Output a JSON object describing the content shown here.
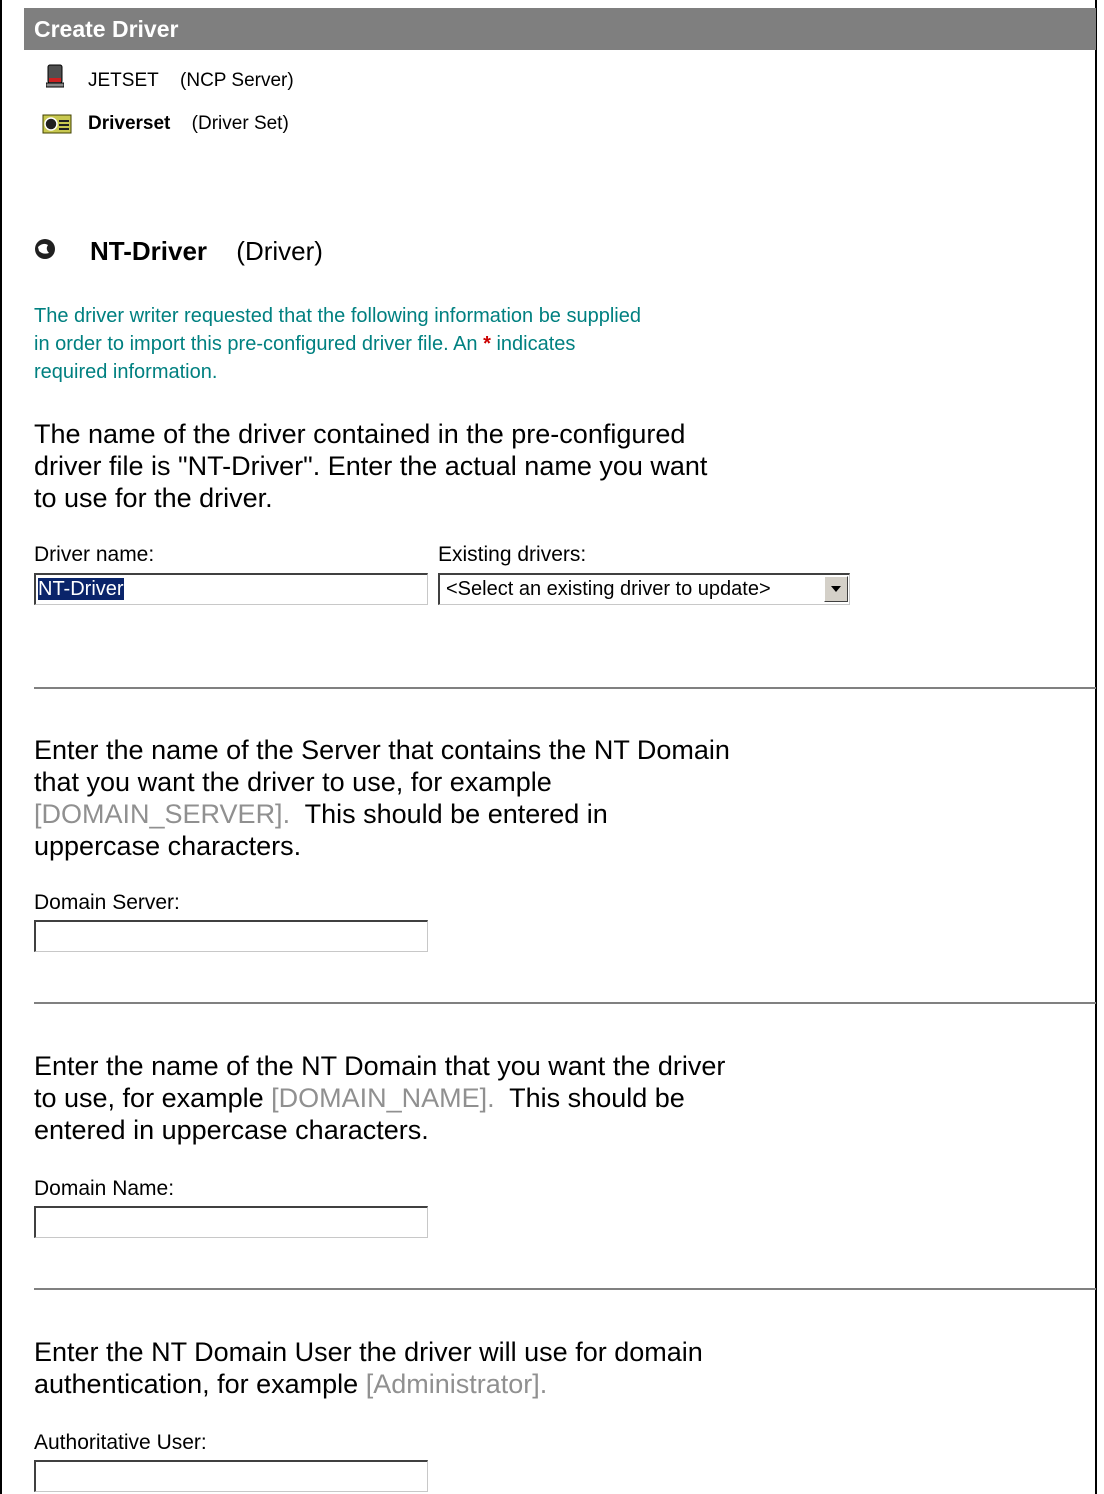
{
  "header": {
    "title": "Create Driver"
  },
  "context": [
    {
      "icon": "server-icon",
      "name": "JETSET",
      "type": "(NCP Server)"
    },
    {
      "icon": "driver-set-icon",
      "name": "Driverset",
      "type": "(Driver Set)"
    }
  ],
  "driver": {
    "icon": "driver-icon",
    "name": "NT-Driver",
    "type": "(Driver)"
  },
  "note": {
    "line1": "The driver writer requested that the following information be supplied",
    "line2a": "in order to import this pre-configured driver file. An ",
    "star": "*",
    "line2b": " indicates",
    "line3": "required information."
  },
  "section_name": {
    "line1": "The name of the driver contained in the pre-configured",
    "line2": "driver file is \"NT-Driver\".  Enter the actual name you want",
    "line3": "to use for the driver.",
    "driver_name_label": "Driver name:",
    "driver_name_value": "NT-Driver",
    "existing_label": "Existing drivers:",
    "existing_selected": "<Select an existing driver to update>"
  },
  "section_server": {
    "line1": "Enter the name of the Server that contains the NT Domain",
    "line2": "that you want the driver to use, for example",
    "example": "[DOMAIN_SERVER].",
    "line3b": "  This should be entered in",
    "line4": "uppercase characters.",
    "label": "Domain Server:",
    "value": ""
  },
  "section_domain": {
    "line1": "Enter the name of the NT Domain that you want the driver",
    "line2a": "to use, for example ",
    "example": "[DOMAIN_NAME].",
    "line2b": "  This should be",
    "line3": "entered in uppercase characters.",
    "label": "Domain Name:",
    "value": ""
  },
  "section_user": {
    "line1": "Enter the NT Domain User the driver will use for domain",
    "line2a": "authentication, for example ",
    "example": "[Administrator].",
    "label": "Authoritative User:",
    "value": ""
  }
}
